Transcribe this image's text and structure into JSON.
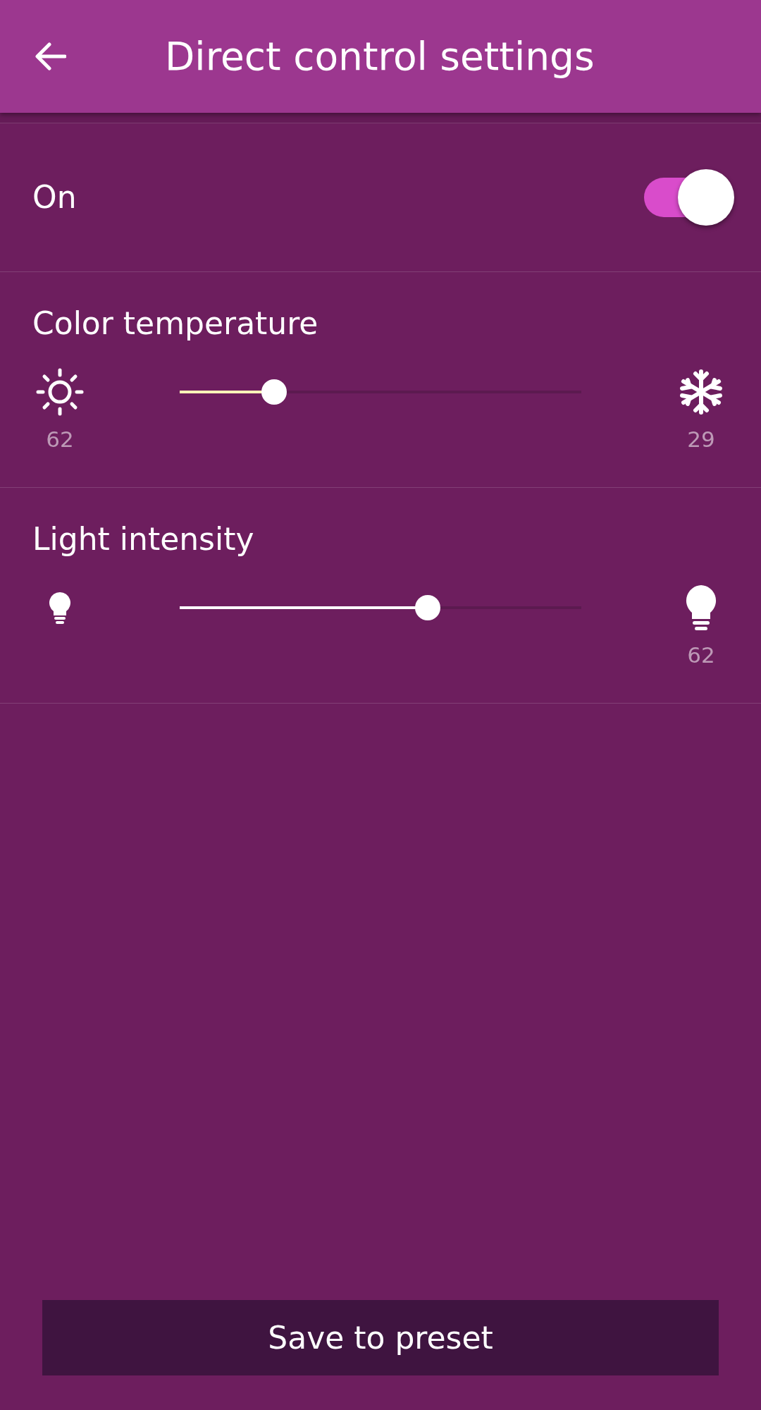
{
  "header": {
    "title": "Direct control settings"
  },
  "power": {
    "label": "On",
    "on": true
  },
  "sliders": [
    {
      "label": "Color temperature",
      "kind": "temperature",
      "level": 0.235,
      "left_reading": "62",
      "right_reading": "29"
    },
    {
      "label": "Light intensity",
      "kind": "intensity",
      "level": 0.617,
      "right_reading": "62"
    }
  ],
  "button": {
    "label": "Save to preset"
  }
}
